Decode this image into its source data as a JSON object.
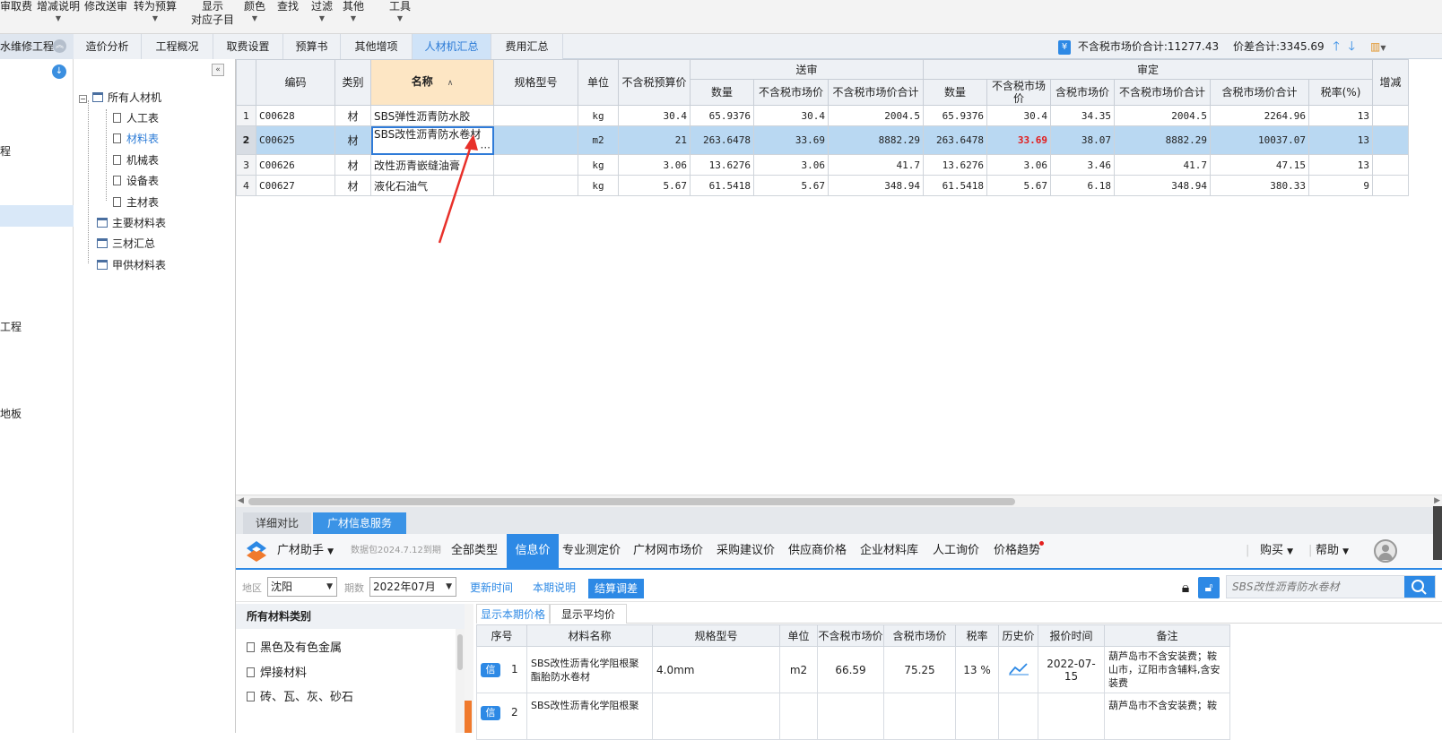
{
  "toolbar": {
    "items": [
      {
        "label": "审取费",
        "has_arrow": false
      },
      {
        "label": "增减说明",
        "has_arrow": true
      },
      {
        "label": "修改送审",
        "has_arrow": false
      },
      {
        "label": "转为预算",
        "has_arrow": true
      },
      {
        "label": "显示",
        "label2": "对应子目",
        "has_arrow": false
      },
      {
        "label": "颜色",
        "has_arrow": true
      },
      {
        "label": "查找",
        "has_arrow": false
      },
      {
        "label": "过滤",
        "has_arrow": true
      },
      {
        "label": "其他",
        "has_arrow": true
      },
      {
        "label": "工具",
        "has_arrow": true
      }
    ]
  },
  "project": {
    "title": "水维修工程"
  },
  "tabs": [
    "造价分析",
    "工程概况",
    "取费设置",
    "预算书",
    "其他增项",
    "人材机汇总",
    "费用汇总"
  ],
  "active_tab": "人材机汇总",
  "summary": {
    "market_total": "不含税市场价合计:11277.43",
    "diff_total": "价差合计:3345.69"
  },
  "left_partial": [
    "程",
    "工程",
    "地板"
  ],
  "tree": {
    "root": "所有人材机",
    "children": [
      "人工表",
      "材料表",
      "机械表",
      "设备表",
      "主材表"
    ],
    "active": "材料表",
    "others": [
      "主要材料表",
      "三材汇总",
      "甲供材料表"
    ]
  },
  "grid": {
    "headers": {
      "code": "编码",
      "type": "类别",
      "name": "名称",
      "spec": "规格型号",
      "unit": "单位",
      "budget_price": "不含税预算价",
      "group_submit": "送审",
      "group_audit": "审定",
      "sub_qty": "数量",
      "sub_mkt": "不含税市场价",
      "sub_mkt_total": "不含税市场价合计",
      "aud_qty": "数量",
      "aud_mkt": "不含税市场价",
      "aud_mkt_tax": "含税市场价",
      "aud_mkt_total": "不含税市场价合计",
      "aud_mkt_tax_total": "含税市场价合计",
      "tax_rate": "税率(%)",
      "extra": "增减"
    },
    "rows": [
      {
        "no": "1",
        "code": "C00628",
        "type": "材",
        "name": "SBS弹性沥青防水胶",
        "spec": "",
        "unit": "kg",
        "budget": "30.4",
        "s_qty": "65.9376",
        "s_price": "30.4",
        "s_total": "2004.5",
        "a_qty": "65.9376",
        "a_price": "30.4",
        "a_tax_price": "34.35",
        "a_total": "2004.5",
        "a_tax_total": "2264.96",
        "rate": "13"
      },
      {
        "no": "2",
        "code": "C00625",
        "type": "材",
        "name": "SBS改性沥青防水卷材",
        "spec": "",
        "unit": "m2",
        "budget": "21",
        "s_qty": "263.6478",
        "s_price": "33.69",
        "s_total": "8882.29",
        "a_qty": "263.6478",
        "a_price": "33.69",
        "a_tax_price": "38.07",
        "a_total": "8882.29",
        "a_tax_total": "10037.07",
        "rate": "13"
      },
      {
        "no": "3",
        "code": "C00626",
        "type": "材",
        "name": "改性沥青嵌缝油膏",
        "spec": "",
        "unit": "kg",
        "budget": "3.06",
        "s_qty": "13.6276",
        "s_price": "3.06",
        "s_total": "41.7",
        "a_qty": "13.6276",
        "a_price": "3.06",
        "a_tax_price": "3.46",
        "a_total": "41.7",
        "a_tax_total": "47.15",
        "rate": "13"
      },
      {
        "no": "4",
        "code": "C00627",
        "type": "材",
        "name": "液化石油气",
        "spec": "",
        "unit": "kg",
        "budget": "5.67",
        "s_qty": "61.5418",
        "s_price": "5.67",
        "s_total": "348.94",
        "a_qty": "61.5418",
        "a_price": "5.67",
        "a_tax_price": "6.18",
        "a_total": "348.94",
        "a_tax_total": "380.33",
        "rate": "9"
      }
    ],
    "edit_dots": "···"
  },
  "bottom": {
    "tabs": [
      "详细对比",
      "广材信息服务"
    ],
    "active_tab": "广材信息服务",
    "assistant": "广材助手",
    "package": "数据包2024.7.12到期",
    "nav": [
      "全部类型",
      "信息价",
      "专业测定价",
      "广材网市场价",
      "采购建议价",
      "供应商价格",
      "企业材料库",
      "人工询价",
      "价格趋势"
    ],
    "active_nav": "信息价",
    "buy": "购买",
    "help": "帮助",
    "region_label": "地区",
    "region": "沈阳",
    "period_label": "期数",
    "period": "2022年07月",
    "update_time": "更新时间",
    "period_note": "本期说明",
    "settle": "结算调差",
    "search_placeholder": "SBS改性沥青防水卷材",
    "cat_title": "所有材料类别",
    "categories": [
      "黑色及有色金属",
      "焊接材料",
      "砖、瓦、灰、砂石"
    ],
    "price_tabs": [
      "显示本期价格",
      "显示平均价"
    ],
    "price_headers": [
      "序号",
      "材料名称",
      "规格型号",
      "单位",
      "不含税市场价",
      "含税市场价",
      "税率",
      "历史价",
      "报价时间",
      "备注"
    ],
    "price_rows": [
      {
        "tag": "信",
        "no": "1",
        "name": "SBS改性沥青化学阻根聚酯胎防水卷材",
        "spec": "4.0mm",
        "unit": "m2",
        "price": "66.59",
        "tax_price": "75.25",
        "rate": "13 %",
        "time": "2022-07-15",
        "note": "葫芦岛市不含安装费；鞍山市，辽阳市含辅料,含安装费"
      },
      {
        "tag": "信",
        "no": "2",
        "name": "SBS改性沥青化学阻根聚",
        "spec": "",
        "unit": "",
        "price": "",
        "tax_price": "",
        "rate": "",
        "time": "",
        "note": "葫芦岛市不含安装费；鞍"
      }
    ]
  },
  "colors": {
    "accent": "#2d89e5",
    "selected_row": "#b9d8f2",
    "highlight": "#e21b1b",
    "name_header": "#fde6c4"
  }
}
